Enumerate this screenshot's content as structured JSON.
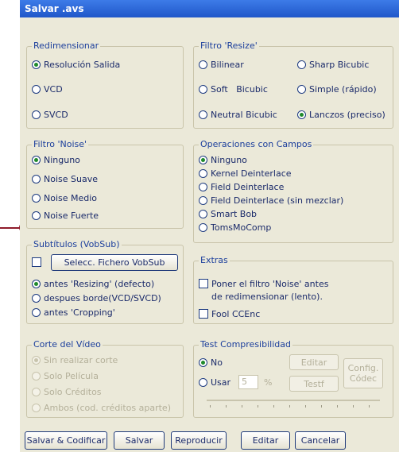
{
  "window": {
    "title": "Salvar .avs"
  },
  "redimensionar": {
    "title": "Redimensionar",
    "options": [
      "Resolución Salida",
      "VCD",
      "SVCD"
    ]
  },
  "filtro_resize": {
    "title": "Filtro 'Resize'",
    "options": [
      "Bilinear",
      "Sharp  Bicubic",
      "Soft   Bicubic",
      "Simple (rápido)",
      "Neutral Bicubic",
      "Lanczos (preciso)"
    ]
  },
  "filtro_noise": {
    "title": "Filtro 'Noise'",
    "options": [
      "Ninguno",
      "Noise Suave",
      "Noise Medio",
      "Noise Fuerte"
    ]
  },
  "operaciones_campos": {
    "title": "Operaciones con Campos",
    "options": [
      "Ninguno",
      "Kernel Deinterlace",
      "Field Deinterlace",
      "Field Deinterlace (sin mezclar)",
      "Smart Bob",
      "TomsMoComp"
    ]
  },
  "subtitulos": {
    "title": "Subtítulos (VobSub)",
    "select_button": "Selecc. Fichero VobSub",
    "options": [
      "antes 'Resizing' (defecto)",
      "despues borde(VCD/SVCD)",
      "antes 'Cropping'"
    ]
  },
  "extras": {
    "title": "Extras",
    "noise_line1": "Poner el filtro 'Noise' antes",
    "noise_line2": "de redimensionar (lento).",
    "fool": "Fool CCEnc"
  },
  "corte": {
    "title": "Corte del Vídeo",
    "options": [
      "Sin realizar corte",
      "Solo Película",
      "Solo Créditos",
      "Ambos (cod. créditos aparte)"
    ]
  },
  "test": {
    "title": "Test Compresibilidad",
    "no": "No",
    "usar": "Usar",
    "value": "5",
    "percent": "%",
    "editar": "Editar",
    "testf": "Testf",
    "config_line1": "Config.",
    "config_line2": "Códec"
  },
  "buttons": {
    "salvar_codificar": "Salvar & Codificar",
    "salvar": "Salvar",
    "reproducir": "Reproducir",
    "editar": "Editar",
    "cancelar": "Cancelar"
  },
  "colors": {
    "accent": "#8e1b2a",
    "titlebar": "#2a63d6",
    "group_title": "#1c3f9c"
  }
}
